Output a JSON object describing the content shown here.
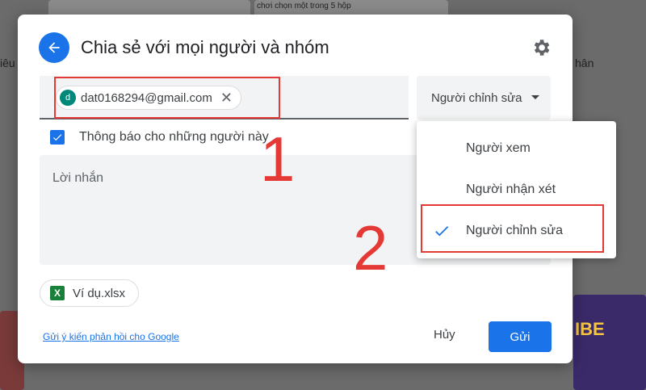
{
  "background": {
    "left_label_1": "iêu",
    "left_label_2": "hân",
    "snippet": "chơi chọn một trong 5 hộp",
    "snippet2": "IBE"
  },
  "dialog": {
    "title": "Chia sẻ với mọi người và nhóm",
    "recipient": {
      "avatar_letter": "d",
      "email": "dat0168294@gmail.com"
    },
    "role_select": {
      "value": "Người chỉnh sửa"
    },
    "notify_label": "Thông báo cho những người này",
    "message_placeholder": "Lời nhắn",
    "attachment": {
      "icon_letter": "X",
      "name": "Ví dụ.xlsx"
    },
    "feedback_link": "Gửi ý kiến phản hồi cho Google",
    "cancel_label": "Hủy",
    "send_label": "Gửi"
  },
  "role_menu": {
    "items": [
      {
        "label": "Người xem",
        "selected": false
      },
      {
        "label": "Người nhận xét",
        "selected": false
      },
      {
        "label": "Người chỉnh sửa",
        "selected": true
      }
    ]
  },
  "annotations": {
    "step1": "1",
    "step2": "2"
  },
  "colors": {
    "accent": "#1a73e8",
    "annotation": "#e53935"
  }
}
